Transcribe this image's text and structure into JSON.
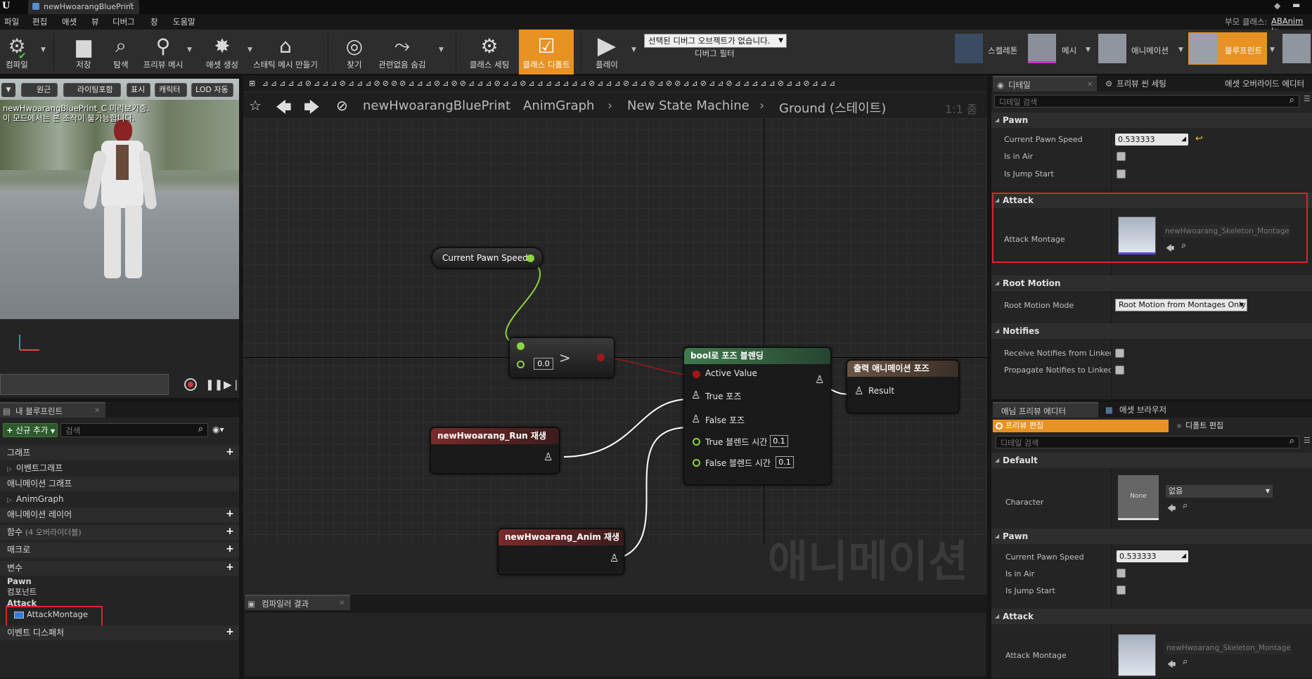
{
  "titlebar": {
    "app_logo": "U",
    "tab": "newHwoarangBluePrint",
    "parent_class_label": "부모 클래스:",
    "parent_class_value": "ABAnim In"
  },
  "menu": [
    "파일",
    "편집",
    "애셋",
    "뷰",
    "디버그",
    "창",
    "도움말"
  ],
  "toolbar": {
    "compile": "컴파일",
    "save": "저장",
    "browse": "탐색",
    "preview_mesh": "프리뷰 메시",
    "create_asset": "애셋 생성",
    "static_mesh": "스태틱 메시 만들기",
    "find": "찾기",
    "hide_unrelated": "관련없음 숨김",
    "class_settings": "클래스 세팅",
    "class_defaults": "클래스 디폴트",
    "play": "플레이",
    "debug_select": "선택된 디버그 오브젝트가 없습니다.",
    "debug_filter": "디버그 필터"
  },
  "mode_tabs": [
    "스켈레톤",
    "메시",
    "애니메이션",
    "블루프린트"
  ],
  "viewport": {
    "perspective": "원근",
    "lighting": "라이팅포함",
    "show": "표시",
    "character": "캐릭터",
    "lod": "LOD 자동",
    "info_line1": "newHwoarangBluePrint_C 미리보기중.",
    "info_line2": "이 모드에서는 본 조작이 불가능합니다."
  },
  "my_blueprint": {
    "tab": "내 블루프린트",
    "add_new": "신규 추가",
    "search_placeholder": "검색",
    "graphs": "그래프",
    "event_graph": "이벤트그래프",
    "anim_graphs": "애니메이션 그래프",
    "anim_graph": "AnimGraph",
    "anim_layers": "애니메이션 레이어",
    "functions": "함수",
    "functions_count": "(4 오버라이더블)",
    "macros": "매크로",
    "variables": "변수",
    "pawn": "Pawn",
    "components": "컴포넌트",
    "attack": "Attack",
    "attack_montage": "AttackMontage",
    "event_dispatchers": "이벤트 디스패처"
  },
  "graph": {
    "breadcrumb": [
      "newHwoarangBluePrint",
      "AnimGraph",
      "New State Machine",
      "Ground (스테이트)"
    ],
    "zoom": "1:1 줌",
    "watermark": "애니메이션",
    "nodes": {
      "speed": "Current Pawn Speed",
      "compare_value": "0.0",
      "compare_op": ">",
      "blend_title": "bool로 포즈 블렌딩",
      "active_value": "Active Value",
      "true_pose": "True 포즈",
      "false_pose": "False 포즈",
      "true_blend": "True 블렌드 시간",
      "true_blend_val": "0.1",
      "false_blend": "False 블렌드 시간",
      "false_blend_val": "0.1",
      "output_title": "출력 애니메이션 포즈",
      "result": "Result",
      "run": "newHwoarang_Run 재생",
      "anim": "newHwoarang_Anim 재생"
    }
  },
  "compiler": {
    "tab": "컴파일러 결과"
  },
  "details": {
    "tabs": [
      "디테일",
      "프리뷰 씬 세팅",
      "애셋 오버라이드 에디터"
    ],
    "search_placeholder": "디테일 검색",
    "pawn": "Pawn",
    "current_pawn_speed": "Current Pawn Speed",
    "speed_value": "0.533333",
    "is_in_air": "Is in Air",
    "is_jump_start": "Is Jump Start",
    "attack": "Attack",
    "attack_montage": "Attack Montage",
    "montage_value": "newHwoarang_Skeleton_Montage",
    "root_motion": "Root Motion",
    "root_motion_mode": "Root Motion Mode",
    "root_motion_value": "Root Motion from Montages Only",
    "notifies": "Notifies",
    "receive_notifies": "Receive Notifies from Linked In",
    "propagate_notifies": "Propagate Notifies to Linked In"
  },
  "anim_preview": {
    "tabs": [
      "애님 프리뷰 에디터",
      "애셋 브라우저"
    ],
    "preview_edit": "프리뷰 편집",
    "default_edit": "디폴트 편집",
    "search_placeholder": "디테일 검색",
    "default": "Default",
    "character": "Character",
    "none": "None",
    "none_select": "없음",
    "pawn": "Pawn",
    "current_pawn_speed": "Current Pawn Speed",
    "speed_value": "0.533333",
    "is_in_air": "Is in Air",
    "is_jump_start": "Is Jump Start",
    "attack": "Attack",
    "attack_montage": "Attack Montage",
    "montage_value": "newHwoarang_Skeleton_Montage"
  },
  "colors": {
    "accent": "#e79222",
    "highlight": "#e0222a",
    "exec_green": "#8fd33d",
    "bool_red": "#a01818",
    "anim_header": "#6b2b2b",
    "blend_header": "#2e5a38"
  }
}
